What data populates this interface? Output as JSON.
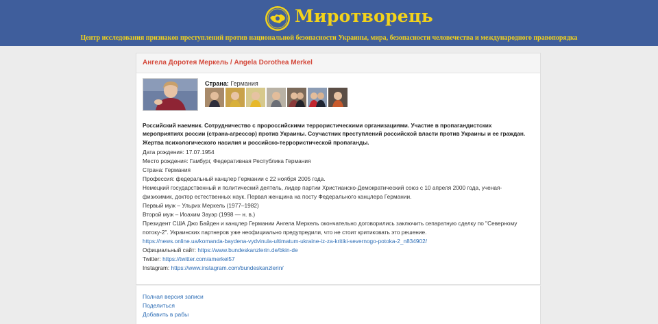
{
  "header": {
    "site_name": "Миротворець",
    "subtitle": "Центр исследования признаков преступлений против национальной безопасности Украины, мира, безопасности человечества и международного правопорядка"
  },
  "record": {
    "title": "Ангела Доротея Меркель / Angela Dorothea Merkel",
    "country_label": "Страна:",
    "country_value": "Германия",
    "lead": "Российский наемник. Сотрудничество с пророссийскими террористическими организациями. Участие в пропагандистских мероприятиях россии (страна-агрессор) против Украины. Соучастник преступлений российской власти против Украины и ее граждан. Жертва психологического насилия и российско-террористической пропаганды.",
    "birth_date": "Дата рождения: 17.07.1954",
    "birth_place": "Место рождения: Гамбург, Федеративная Республика Германия",
    "country_line": "Страна: Германия",
    "profession": "Профессия: федеральный канцлер Германии с 22 ноября 2005 года.",
    "bio": "Немецкий государственный и политический деятель, лидер партии Христианско-Демократический союз с 10 апреля 2000 года, ученая-физихимик, доктор естественных наук. Первая женщина на посту Федерального канцлера Германии.",
    "husband1": "Первый муж – Ульрих Меркель (1977–1982)",
    "husband2": "Второй муж – Иоахим Зауэр (1998 — н. в.)",
    "news": "Президент США Джо Байден и канцлер Германии Ангела Меркель окончательно договорились заключить сепаратную сделку по \"Северному потоку-2\". Украинских партнеров уже неофициально предупредили, что не стоит критиковать это решение.",
    "news_link": "https://news.online.ua/komanda-baydena-vydvinula-ultimatum-ukraine-iz-za-kritiki-severnogo-potoka-2_n834902/",
    "site_label": "Официальный сайт:",
    "site_link": "https://www.bundeskanzlerin.de/bkin-de",
    "twitter_label": "Twitter:",
    "twitter_link": "https://twitter.com/amerkel57",
    "instagram_label": "Instagram:",
    "instagram_link": "https://www.instagram.com/bundeskanzlerin/",
    "thumbnail_count": 7
  },
  "footer": {
    "full_version": "Полная версия записи",
    "share": "Поделиться",
    "add_to_slaves": "Добавить в рабы"
  },
  "colors": {
    "header_bg": "#3f5e9c",
    "title_yellow": "#f3d31a",
    "record_title_red": "#d4493b",
    "link_blue": "#2d6db5",
    "page_bg": "#ececec"
  },
  "icons": [
    "emblem-icon"
  ]
}
